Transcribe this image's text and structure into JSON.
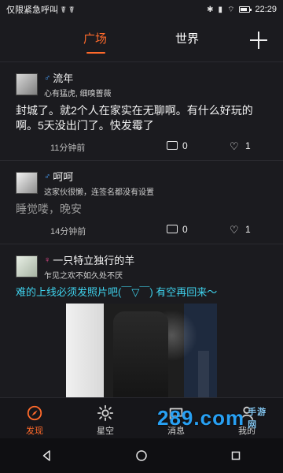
{
  "status_bar": {
    "left_text": "仅限紧急呼叫 ☤ ☤",
    "time": "22:29"
  },
  "top_nav": {
    "tabs": [
      {
        "label": "广场"
      },
      {
        "label": "世界"
      }
    ]
  },
  "posts": [
    {
      "name": "流年",
      "gender": "male",
      "bio": "心有猛虎, 细嗅蔷薇",
      "content": "封城了。就2个人在家实在无聊啊。有什么好玩的啊。5天没出门了。快发霉了",
      "time": "11分钟前",
      "comments": "0",
      "likes": "1"
    },
    {
      "name": "呵呵",
      "gender": "male",
      "bio": "这家伙很懒，连签名都没有设置",
      "content": "睡觉喽，晚安",
      "time": "14分钟前",
      "comments": "0",
      "likes": "1"
    },
    {
      "name": "一只特立独行的羊",
      "gender": "female",
      "bio": "乍见之欢不如久处不厌",
      "content": "难的上线必须发照片吧(￣▽￣) 有空再回来～"
    }
  ],
  "bottom_tabs": [
    {
      "label": "发现"
    },
    {
      "label": "星空"
    },
    {
      "label": "消息"
    },
    {
      "label": "我的"
    }
  ],
  "watermark": {
    "text": "289.com",
    "subtext": "手游网"
  },
  "colors": {
    "accent": "#ff6a2b",
    "cyan_text": "#3fd3ee",
    "male": "#4aa3ff",
    "female": "#ff4f9a"
  }
}
